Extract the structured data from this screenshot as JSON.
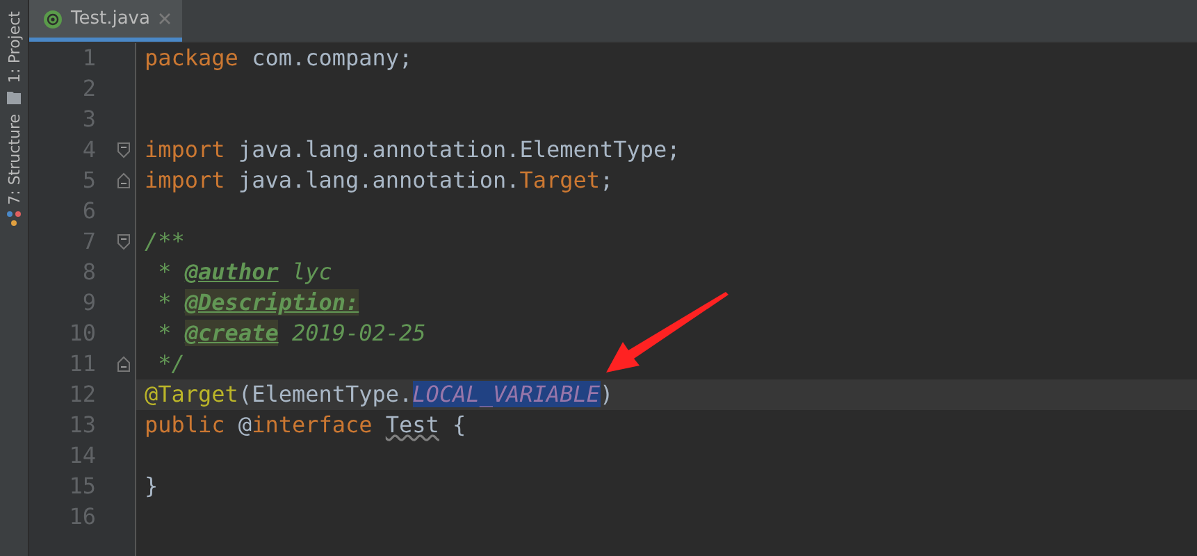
{
  "tool_strip": [
    {
      "label": "1: Project",
      "kind": "project"
    },
    {
      "label": "7: Structure",
      "kind": "structure"
    }
  ],
  "tabs": [
    {
      "label": "Test.java",
      "selected": true
    }
  ],
  "lines": [
    {
      "number": "1",
      "tokens": [
        {
          "text": "package",
          "kind": "keyword"
        },
        {
          "text": " com.company;",
          "kind": "plain"
        }
      ]
    },
    {
      "number": "2"
    },
    {
      "number": "3"
    },
    {
      "number": "4",
      "fold_start": true,
      "tokens": [
        {
          "text": "import",
          "kind": "keyword"
        },
        {
          "text": " java.lang.annotation.ElementType;",
          "kind": "plain"
        }
      ]
    },
    {
      "number": "5",
      "fold_end": true,
      "tokens": [
        {
          "text": "import",
          "kind": "keyword"
        },
        {
          "text": " java.lang.annotation.",
          "kind": "plain"
        },
        {
          "text": "Target",
          "kind": "keyword"
        },
        {
          "text": ";",
          "kind": "plain"
        }
      ]
    },
    {
      "number": "6"
    },
    {
      "number": "7",
      "fold_start": true,
      "tokens": [
        {
          "text": "/**",
          "kind": "comment"
        }
      ]
    },
    {
      "number": "8",
      "tokens": [
        {
          "text": " * ",
          "kind": "comment"
        },
        {
          "text": "@author",
          "kind": "doctag"
        },
        {
          "text": " lyc",
          "kind": "comment"
        }
      ]
    },
    {
      "number": "9",
      "tokens": [
        {
          "text": " * ",
          "kind": "comment"
        },
        {
          "text": "@Description:",
          "kind": "doctag-marked"
        }
      ]
    },
    {
      "number": "10",
      "tokens": [
        {
          "text": " * ",
          "kind": "comment"
        },
        {
          "text": "@create",
          "kind": "doctag-marked"
        },
        {
          "text": " 2019-02-25",
          "kind": "comment"
        }
      ]
    },
    {
      "number": "11",
      "fold_end": true,
      "tokens": [
        {
          "text": " */",
          "kind": "comment"
        }
      ]
    },
    {
      "number": "12",
      "current": true,
      "tokens": [
        {
          "text": "@Target",
          "kind": "annotation"
        },
        {
          "text": "(ElementType.",
          "kind": "plain"
        },
        {
          "text": "LOCAL_VARIABLE",
          "kind": "constant",
          "selected": true
        },
        {
          "text": ")",
          "kind": "plain"
        }
      ]
    },
    {
      "number": "13",
      "tokens": [
        {
          "text": "public",
          "kind": "keyword"
        },
        {
          "text": " @",
          "kind": "plain"
        },
        {
          "text": "interface ",
          "kind": "keyword"
        },
        {
          "text": "Test",
          "kind": "warning"
        },
        {
          "text": " {",
          "kind": "plain"
        }
      ]
    },
    {
      "number": "14"
    },
    {
      "number": "15",
      "tokens": [
        {
          "text": "}",
          "kind": "plain"
        }
      ]
    },
    {
      "number": "16"
    }
  ]
}
